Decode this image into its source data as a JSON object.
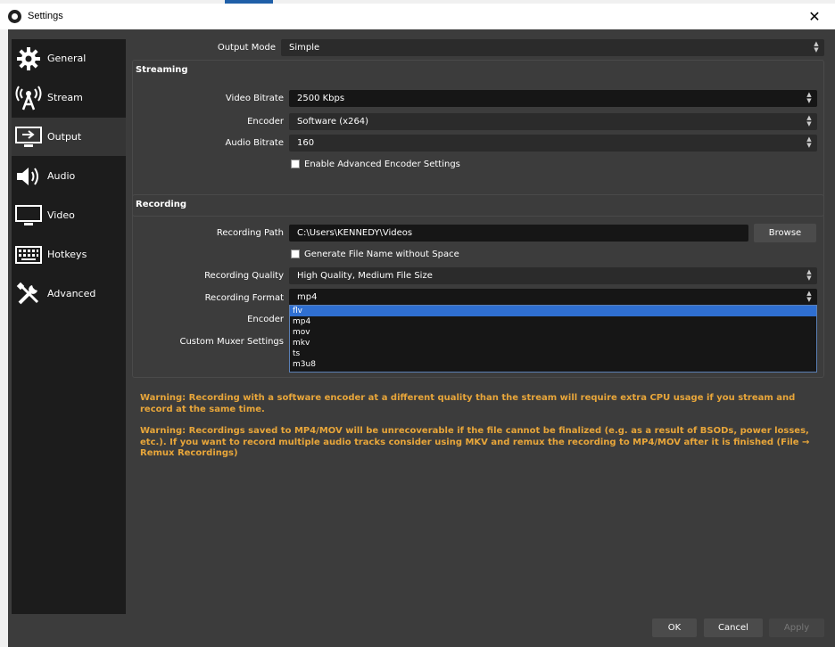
{
  "window": {
    "title": "Settings"
  },
  "sidebar": {
    "items": [
      {
        "label": "General",
        "icon": "gear-icon"
      },
      {
        "label": "Stream",
        "icon": "broadcast-icon"
      },
      {
        "label": "Output",
        "icon": "monitor-output-icon",
        "active": true
      },
      {
        "label": "Audio",
        "icon": "speaker-icon"
      },
      {
        "label": "Video",
        "icon": "monitor-icon"
      },
      {
        "label": "Hotkeys",
        "icon": "keyboard-icon"
      },
      {
        "label": "Advanced",
        "icon": "tools-icon"
      }
    ]
  },
  "output_mode": {
    "label": "Output Mode",
    "value": "Simple"
  },
  "streaming": {
    "title": "Streaming",
    "video_bitrate": {
      "label": "Video Bitrate",
      "value": "2500 Kbps"
    },
    "encoder": {
      "label": "Encoder",
      "value": "Software (x264)"
    },
    "audio_bitrate": {
      "label": "Audio Bitrate",
      "value": "160"
    },
    "advanced_encoder": {
      "label": "Enable Advanced Encoder Settings",
      "checked": false
    }
  },
  "recording": {
    "title": "Recording",
    "path": {
      "label": "Recording Path",
      "value": "C:\\Users\\KENNEDY\\Videos"
    },
    "browse_label": "Browse",
    "no_space": {
      "label": "Generate File Name without Space",
      "checked": false
    },
    "quality": {
      "label": "Recording Quality",
      "value": "High Quality, Medium File Size"
    },
    "format": {
      "label": "Recording Format",
      "value": "mp4"
    },
    "encoder_label": "Encoder",
    "muxer_label": "Custom Muxer Settings",
    "format_options": [
      "flv",
      "mp4",
      "mov",
      "mkv",
      "ts",
      "m3u8"
    ],
    "highlighted_option": "flv"
  },
  "warnings": {
    "software_encoder": "Warning: Recording with a software encoder at a different quality than the stream will require extra CPU usage if you stream and record at the same time.",
    "mp4": "Warning: Recordings saved to MP4/MOV will be unrecoverable if the file cannot be finalized (e.g. as a result of BSODs, power losses, etc.). If you want to record multiple audio tracks consider using MKV and remux the recording to MP4/MOV after it is finished (File → Remux Recordings)"
  },
  "buttons": {
    "ok": "OK",
    "cancel": "Cancel",
    "apply": "Apply"
  },
  "colors": {
    "warning": "#e8a63a",
    "selection": "#2f6fd1",
    "background": "#3c3c3c",
    "sidebar": "#1c1c1c"
  }
}
